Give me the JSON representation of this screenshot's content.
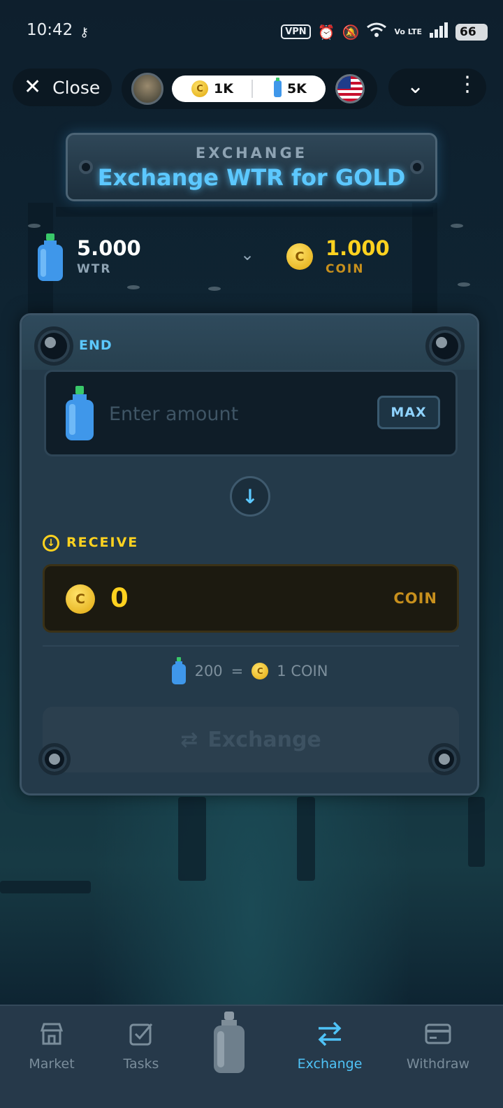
{
  "status_bar": {
    "time": "10:42",
    "vpn": "VPN",
    "volte": "Vo LTE",
    "battery": "66",
    "icons": [
      "key-icon",
      "vpn-icon",
      "alarm-icon",
      "mute-icon",
      "wifi-icon",
      "volte-icon",
      "signal-icon",
      "battery-icon"
    ]
  },
  "top_bar": {
    "close_label": "Close",
    "coins": "1K",
    "water": "5K",
    "coin_symbol": "C"
  },
  "banner": {
    "subtitle": "EXCHANGE",
    "title": "Exchange WTR for GOLD"
  },
  "balances": {
    "wtr_value": "5.000",
    "wtr_label": "WTR",
    "coin_value": "1.000",
    "coin_label": "COIN",
    "coin_symbol": "C"
  },
  "send": {
    "label": "END",
    "placeholder": "Enter amount",
    "value": "",
    "max_label": "MAX"
  },
  "receive": {
    "label": "RECEIVE",
    "value": "0",
    "unit": "COIN",
    "coin_symbol": "C"
  },
  "rate": {
    "wtr_amount": "200",
    "equals": "=",
    "coin_amount": "1 COIN",
    "coin_symbol": "C"
  },
  "exchange_button": {
    "label": "Exchange"
  },
  "nav": {
    "items": [
      {
        "label": "Market",
        "icon": "store-icon"
      },
      {
        "label": "Tasks",
        "icon": "checkbox-icon"
      },
      {
        "label": "",
        "icon": "water-bottle-icon"
      },
      {
        "label": "Exchange",
        "icon": "swap-arrows-icon",
        "active": true
      },
      {
        "label": "Withdraw",
        "icon": "card-icon"
      }
    ]
  },
  "colors": {
    "accent_blue": "#5cc8ff",
    "gold": "#ffd21f",
    "nav_active": "#4fc3f7"
  }
}
